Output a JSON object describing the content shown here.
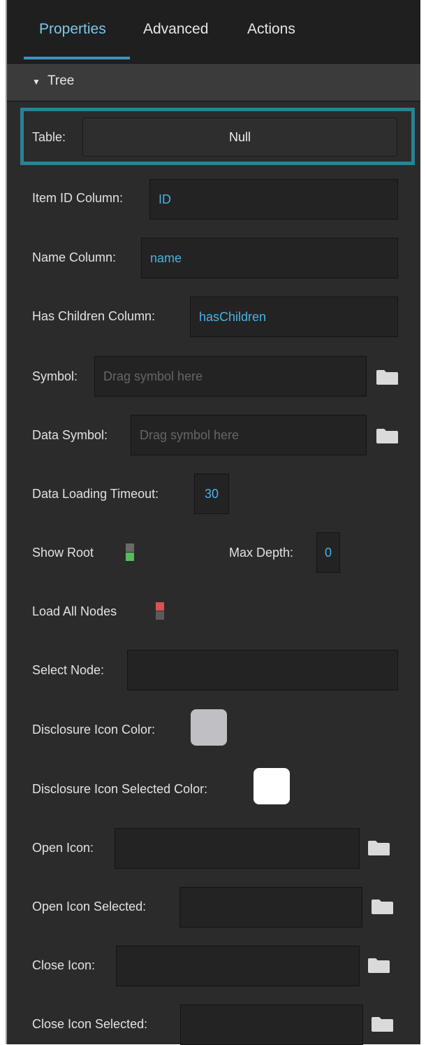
{
  "tabs": [
    {
      "label": "Properties",
      "active": true
    },
    {
      "label": "Advanced",
      "active": false
    },
    {
      "label": "Actions",
      "active": false
    }
  ],
  "section": {
    "arrow": "▼",
    "title": "Tree"
  },
  "fields": {
    "table": {
      "label": "Table:",
      "value": "Null"
    },
    "item_id_column": {
      "label": "Item ID Column:",
      "value": "ID"
    },
    "name_column": {
      "label": "Name Column:",
      "value": "name"
    },
    "has_children_column": {
      "label": "Has Children Column:",
      "value": "hasChildren"
    },
    "symbol": {
      "label": "Symbol:",
      "placeholder": "Drag symbol here",
      "icon": "folder-icon"
    },
    "data_symbol": {
      "label": "Data Symbol:",
      "placeholder": "Drag symbol here",
      "icon": "folder-icon"
    },
    "data_loading_timeout": {
      "label": "Data Loading Timeout:",
      "value": "30"
    },
    "show_root": {
      "label": "Show Root",
      "enabled": true,
      "color": "#5cb85c"
    },
    "max_depth": {
      "label": "Max Depth:",
      "value": "0"
    },
    "load_all_nodes": {
      "label": "Load All Nodes",
      "enabled": false,
      "color": "#d9534f"
    },
    "select_node": {
      "label": "Select Node:",
      "value": ""
    },
    "disclosure_icon_color": {
      "label": "Disclosure Icon Color:",
      "color": "#c0c0c4"
    },
    "disclosure_icon_selected_color": {
      "label": "Disclosure Icon Selected Color:",
      "color": "#ffffff"
    },
    "open_icon": {
      "label": "Open Icon:",
      "value": "",
      "icon": "folder-icon"
    },
    "open_icon_selected": {
      "label": "Open Icon Selected:",
      "value": "",
      "icon": "folder-icon"
    },
    "close_icon": {
      "label": "Close Icon:",
      "value": "",
      "icon": "folder-icon"
    },
    "close_icon_selected": {
      "label": "Close Icon Selected:",
      "value": "",
      "icon": "folder-icon"
    }
  },
  "colors": {
    "accent": "#7dc6ea",
    "value_text": "#47b3e6",
    "highlight_border": "#2a8296"
  }
}
